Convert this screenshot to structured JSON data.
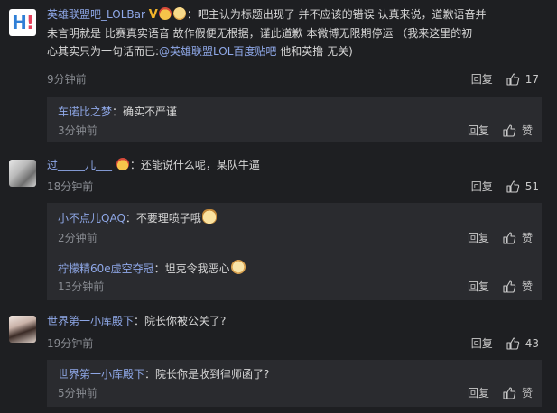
{
  "comments": [
    {
      "user": "英雄联盟吧_LOLBar",
      "text_line1": "：吧主认为标题出现了 并不应该的错误      认真来说，道歉语音并",
      "text_line2": "未言明就是 比赛真实语音       故作假便无根据，谨此道歉      本微博无限期停运  （我来这里的初",
      "text_line3_pre": "心其实只为一句话而已:",
      "text_line3_link": "@英雄联盟LOL百度贴吧",
      "text_line3_post": " 他和英撸 无关)",
      "time": "9分钟前",
      "reply_label": "回复",
      "likes": "17",
      "replies": [
        {
          "user": "车诺比之梦",
          "text": "：确实不严谨",
          "time": "3分钟前",
          "reply_label": "回复",
          "like_label": "赞"
        }
      ]
    },
    {
      "user": "过_____儿___",
      "text": "：还能说什么呢，某队牛逼",
      "time": "18分钟前",
      "reply_label": "回复",
      "likes": "51",
      "replies": [
        {
          "user": "小不点儿QAQ",
          "text": "：不要理喷子哦",
          "time": "2分钟前",
          "reply_label": "回复",
          "like_label": "赞"
        },
        {
          "user": "柠檬精60e虚空夺冠",
          "text": "：坦克令我恶心",
          "time": "13分钟前",
          "reply_label": "回复",
          "like_label": "赞"
        }
      ]
    },
    {
      "user": "世界第一小库殿下",
      "text": "：院长你被公关了?",
      "time": "19分钟前",
      "reply_label": "回复",
      "likes": "43",
      "replies": [
        {
          "user": "世界第一小库殿下",
          "text": "：院长你是收到律师函了?",
          "time": "5分钟前",
          "reply_label": "回复",
          "like_label": "赞"
        }
      ]
    }
  ],
  "colors": {
    "background": "#1e1f22",
    "reply_box": "#2a2b2f",
    "username": "#8fa8e8",
    "time": "#888b91",
    "badge": "#f3b52a"
  },
  "icons": {
    "like": "thumbs-up-icon",
    "avatar_logo": "H!"
  }
}
